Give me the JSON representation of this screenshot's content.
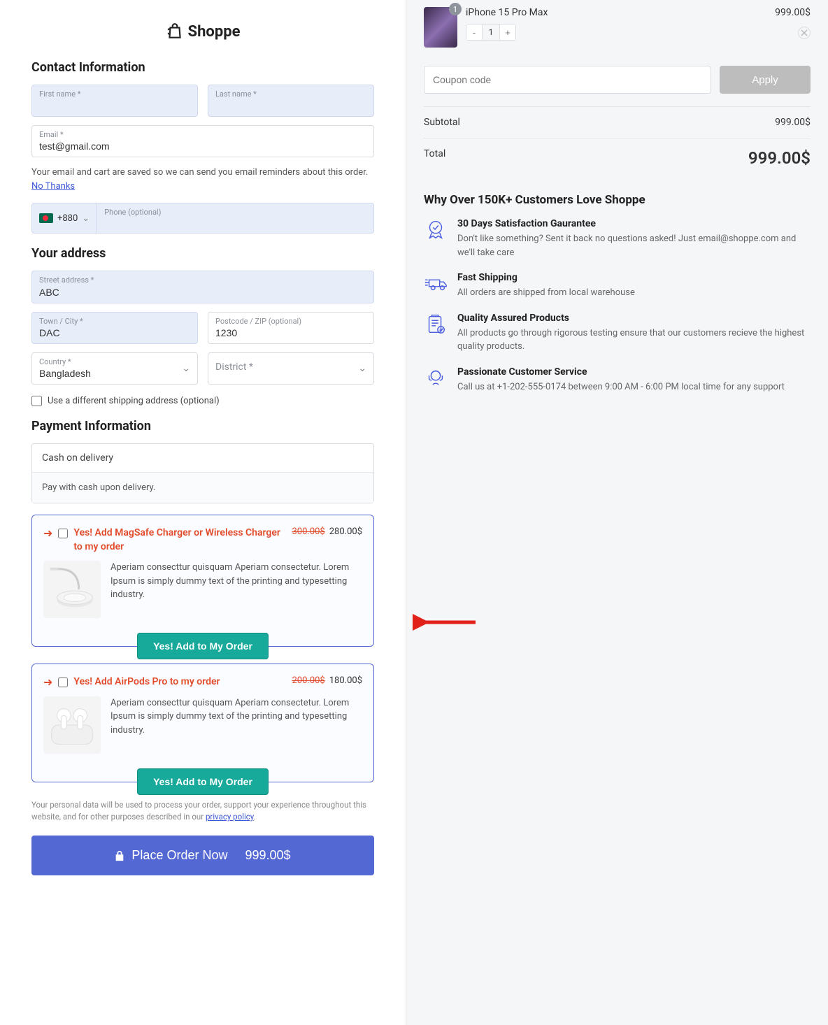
{
  "brand": "Shoppe",
  "sections": {
    "contact": "Contact Information",
    "address": "Your address",
    "payment": "Payment Information"
  },
  "labels": {
    "first_name": "First name *",
    "last_name": "Last name *",
    "email": "Email *",
    "phone": "Phone (optional)",
    "street": "Street address *",
    "town": "Town / City *",
    "postcode": "Postcode / ZIP (optional)",
    "country": "Country *",
    "district": "District *",
    "ship_different": "Use a different shipping address (optional)"
  },
  "values": {
    "email": "test@gmail.com",
    "phone_prefix": "+880",
    "street": "ABC",
    "town": "DAC",
    "postcode": "1230",
    "country": "Bangladesh"
  },
  "contact_note": {
    "text": "Your email and cart are saved so we can send you email reminders about this order. ",
    "link": "No Thanks"
  },
  "payment": {
    "method": "Cash on delivery",
    "desc": "Pay with cash upon delivery."
  },
  "upsells": [
    {
      "title": "Yes! Add MagSafe Charger or Wireless Charger to my order",
      "old_price": "300.00$",
      "new_price": "280.00$",
      "desc": "Aperiam consecttur quisquam Aperiam consectetur. Lorem Ipsum is simply dummy text of the printing and typesetting industry.",
      "btn": "Yes! Add to My Order",
      "icon": "charger"
    },
    {
      "title": "Yes! Add AirPods Pro to my order",
      "old_price": "200.00$",
      "new_price": "180.00$",
      "desc": "Aperiam consecttur quisquam Aperiam consectetur. Lorem Ipsum is simply dummy text of the printing and typesetting industry.",
      "btn": "Yes! Add to My Order",
      "icon": "airpods"
    }
  ],
  "privacy": {
    "text": "Your personal data will be used to process your order, support your experience throughout this website, and for other purposes described in our ",
    "link": "privacy policy"
  },
  "place_order": {
    "label": "Place Order Now",
    "amount": "999.00$"
  },
  "cart": {
    "item": {
      "name": "iPhone 15 Pro Max",
      "qty": "1",
      "badge": "1",
      "price": "999.00$"
    },
    "coupon_placeholder": "Coupon code",
    "apply": "Apply",
    "subtotal_label": "Subtotal",
    "subtotal_value": "999.00$",
    "total_label": "Total",
    "total_value": "999.00$"
  },
  "why": {
    "title": "Why Over 150K+ Customers Love Shoppe",
    "items": [
      {
        "title": "30 Days Satisfaction Gaurantee",
        "desc": "Don't like something? Sent it back no questions asked! Just email@shoppe.com and we'll take care"
      },
      {
        "title": "Fast Shipping",
        "desc": "All orders are shipped from local warehouse"
      },
      {
        "title": "Quality Assured Products",
        "desc": "All products go through rigorous testing ensure that our customers recieve the highest quality products."
      },
      {
        "title": "Passionate Customer Service",
        "desc": "Call us at +1-202-555-0174 between 9:00 AM - 6:00 PM local time for any support"
      }
    ]
  }
}
